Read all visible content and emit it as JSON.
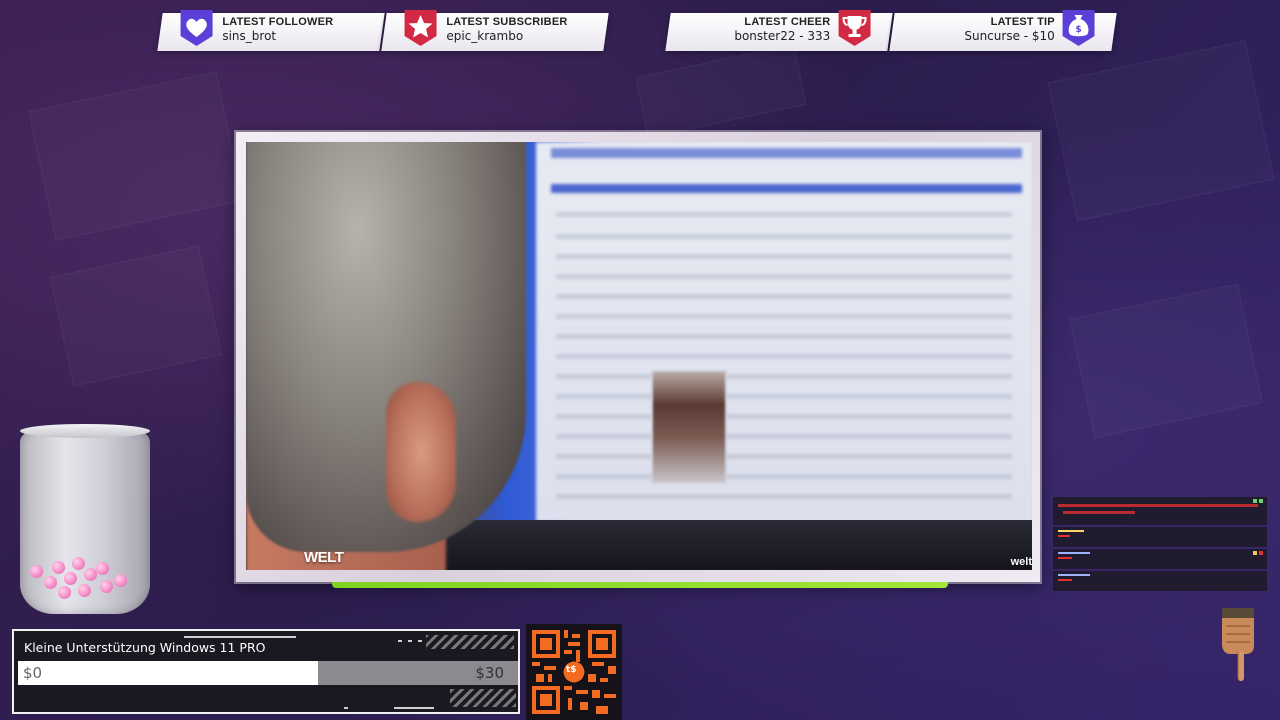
{
  "alerts": {
    "follower": {
      "label": "LATEST FOLLOWER",
      "value": "sins_brot",
      "color": "#5b3fd6",
      "icon": "heart-icon"
    },
    "subscriber": {
      "label": "LATEST SUBSCRIBER",
      "value": "epic_krambo",
      "color": "#d22a44",
      "icon": "star-icon"
    },
    "cheer": {
      "label": "LATEST CHEER",
      "value": "bonster22 - 333",
      "color": "#d22a44",
      "icon": "trophy-icon"
    },
    "tip": {
      "label": "LATEST TIP",
      "value": "Suncurse - $10",
      "color": "#5b3fd6",
      "icon": "money-bag-icon"
    }
  },
  "video": {
    "watermark_left": "WELT",
    "watermark_right": "welt"
  },
  "goal": {
    "title": "Kleine Unterstützung Windows 11 PRO",
    "current": "$0",
    "target": "$30",
    "fill_fraction": 0.6
  },
  "qr": {
    "logo": "t$",
    "color": "#f26b21"
  },
  "chat": {
    "messages": [
      {
        "user": "",
        "text": "",
        "user_color": "#9db3ff",
        "text_color": "#ff3b3b"
      },
      {
        "user": "",
        "text": "",
        "user_color": "#ffd36b",
        "text_color": "#ff3b3b"
      },
      {
        "user": "",
        "text": "",
        "user_color": "#9db3ff",
        "text_color": "#ff3b3b"
      },
      {
        "user": "",
        "text": "",
        "user_color": "#9db3ff",
        "text_color": "#ff3b3b"
      }
    ]
  },
  "colors": {
    "background": "#2c1d4e",
    "goal_bar_fill": "#ffffff",
    "progress_green": "#7ed321"
  }
}
